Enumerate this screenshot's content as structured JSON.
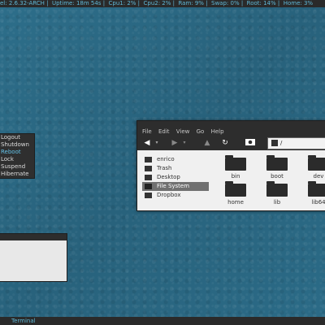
{
  "status_bar": {
    "kernel": "el: 2.6.32-ARCH",
    "uptime": "Uptime: 18m 54s",
    "cpu1": "Cpu1: 2%",
    "cpu2": "Cpu2: 2%",
    "ram": "Ram: 9%",
    "swap": "Swap: 0%",
    "root": "Root: 14%",
    "home": "Home: 3%"
  },
  "logout_menu": {
    "items": [
      "Logout",
      "Shutdown",
      "Reboot",
      "Lock",
      "Suspend",
      "Hibernate"
    ],
    "active_index": 2
  },
  "file_manager": {
    "menu": [
      "File",
      "Edit",
      "View",
      "Go",
      "Help"
    ],
    "path": "/",
    "sidebar": [
      {
        "label": "enrico",
        "icon": "home-icon"
      },
      {
        "label": "Trash",
        "icon": "trash-icon"
      },
      {
        "label": "Desktop",
        "icon": "desktop-icon"
      },
      {
        "label": "File System",
        "icon": "drive-icon"
      },
      {
        "label": "Dropbox",
        "icon": "folder-icon"
      }
    ],
    "selected_sidebar_index": 3,
    "folders": [
      "bin",
      "boot",
      "dev",
      "home",
      "lib",
      "lib64"
    ]
  },
  "taskbar": {
    "task": "Terminal"
  },
  "colors": {
    "accent": "#5fb7d6",
    "desktop": "#2b6a85",
    "panel": "#2a2a2a"
  }
}
